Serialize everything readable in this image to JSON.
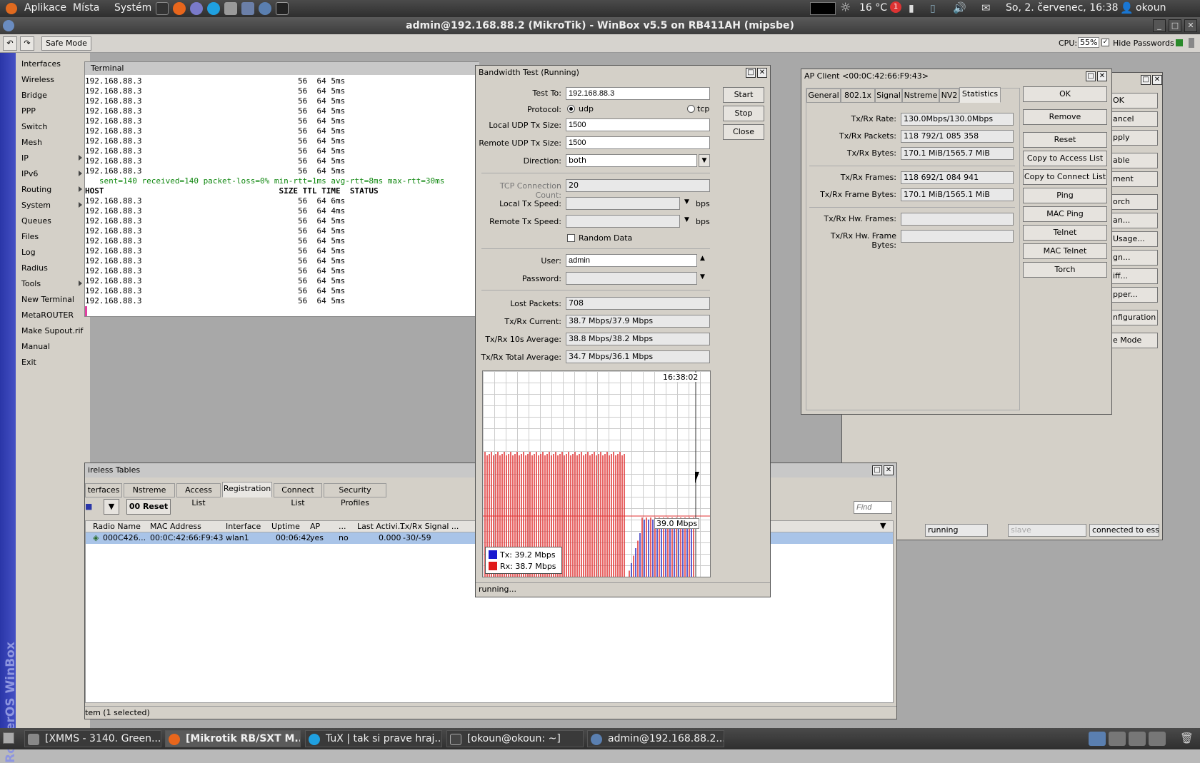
{
  "top_panel": {
    "menus": [
      "Aplikace",
      "Místa",
      "Systém"
    ],
    "temperature": "16 °C",
    "notification_count": "1",
    "datetime": "So, 2. červenec, 16:38",
    "user": "okoun"
  },
  "window": {
    "title": "admin@192.168.88.2 (MikroTik) - WinBox v5.5 on RB411AH (mipsbe)"
  },
  "toolbar": {
    "safe_mode": "Safe Mode",
    "cpu_label": "CPU:",
    "cpu_value": "55%",
    "hide_passwords": "Hide Passwords"
  },
  "sidebar": {
    "vertical_label": "RouterOS WinBox",
    "items": [
      "Interfaces",
      "Wireless",
      "Bridge",
      "PPP",
      "Switch",
      "Mesh",
      "IP",
      "IPv6",
      "Routing",
      "System",
      "Queues",
      "Files",
      "Log",
      "Radius",
      "Tools",
      "New Terminal",
      "MetaROUTER",
      "Make Supout.rif",
      "Manual",
      "Exit"
    ]
  },
  "terminal": {
    "title": "Terminal",
    "lines_top": [
      "192.168.88.3                                 56  64 5ms",
      "192.168.88.3                                 56  64 5ms",
      "192.168.88.3                                 56  64 5ms",
      "192.168.88.3                                 56  64 5ms",
      "192.168.88.3                                 56  64 5ms",
      "192.168.88.3                                 56  64 5ms",
      "192.168.88.3                                 56  64 5ms",
      "192.168.88.3                                 56  64 5ms",
      "192.168.88.3                                 56  64 5ms",
      "192.168.88.3                                 56  64 5ms"
    ],
    "summary": "   sent=140 received=140 packet-loss=0% min-rtt=1ms avg-rtt=8ms max-rtt=30ms",
    "header": "HOST                                     SIZE TTL TIME  STATUS",
    "lines_bottom": [
      "192.168.88.3                                 56  64 6ms",
      "192.168.88.3                                 56  64 4ms",
      "192.168.88.3                                 56  64 5ms",
      "192.168.88.3                                 56  64 5ms",
      "192.168.88.3                                 56  64 5ms",
      "192.168.88.3                                 56  64 5ms",
      "192.168.88.3                                 56  64 5ms",
      "192.168.88.3                                 56  64 5ms",
      "192.168.88.3                                 56  64 5ms",
      "192.168.88.3                                 56  64 5ms",
      "192.168.88.3                                 56  64 5ms"
    ]
  },
  "bandwidth_test": {
    "title": "Bandwidth Test (Running)",
    "test_to_label": "Test To:",
    "test_to": "192.168.88.3",
    "protocol_label": "Protocol:",
    "udp": "udp",
    "tcp": "tcp",
    "local_udp_label": "Local UDP Tx Size:",
    "local_udp": "1500",
    "remote_udp_label": "Remote UDP Tx Size:",
    "remote_udp": "1500",
    "direction_label": "Direction:",
    "direction": "both",
    "tcp_count_label": "TCP Connection Count:",
    "tcp_count": "20",
    "local_tx_label": "Local Tx Speed:",
    "remote_tx_label": "Remote Tx Speed:",
    "bps": "bps",
    "random_data": "Random Data",
    "user_label": "User:",
    "user": "admin",
    "password_label": "Password:",
    "lost_label": "Lost Packets:",
    "lost": "708",
    "current_label": "Tx/Rx Current:",
    "current": "38.7 Mbps/37.9 Mbps",
    "avg10_label": "Tx/Rx 10s Average:",
    "avg10": "38.8 Mbps/38.2 Mbps",
    "total_label": "Tx/Rx Total Average:",
    "total": "34.7 Mbps/36.1 Mbps",
    "start": "Start",
    "stop": "Stop",
    "close": "Close",
    "graph_time": "16:38:02",
    "graph_value": "39.0 Mbps",
    "legend_tx": "Tx:  39.2 Mbps",
    "legend_rx": "Rx:  38.7 Mbps",
    "status": "running..."
  },
  "ap_client": {
    "title": "AP Client <00:0C:42:66:F9:43>",
    "tabs": [
      "General",
      "802.1x",
      "Signal",
      "Nstreme",
      "NV2",
      "Statistics"
    ],
    "rows": [
      {
        "label": "Tx/Rx Rate:",
        "value": "130.0Mbps/130.0Mbps"
      },
      {
        "label": "Tx/Rx Packets:",
        "value": "118 792/1 085 358"
      },
      {
        "label": "Tx/Rx Bytes:",
        "value": "170.1 MiB/1565.7 MiB"
      },
      {
        "label": "Tx/Rx Frames:",
        "value": "118 692/1 084 941"
      },
      {
        "label": "Tx/Rx Frame Bytes:",
        "value": "170.1 MiB/1565.1 MiB"
      },
      {
        "label": "Tx/Rx Hw. Frames:",
        "value": ""
      },
      {
        "label": "Tx/Rx Hw. Frame Bytes:",
        "value": ""
      }
    ],
    "buttons": [
      "OK",
      "Remove",
      "Reset",
      "Copy to Access List",
      "Copy to Connect List",
      "Ping",
      "MAC Ping",
      "Telnet",
      "MAC Telnet",
      "Torch"
    ]
  },
  "back_window": {
    "buttons": [
      "OK",
      "ancel",
      "pply",
      "able",
      "ment",
      "orch",
      "an...",
      "Usage...",
      "gn...",
      "iff...",
      "pper...",
      "nfiguration",
      "e Mode"
    ],
    "status_running": "running",
    "status_slave": "slave",
    "status_connected": "connected to ess"
  },
  "wireless_tables": {
    "title": "ireless Tables",
    "tabs": [
      "terfaces",
      "Nstreme Dual",
      "Access List",
      "Registration",
      "Connect List",
      "Security Profiles"
    ],
    "reset": "00 Reset",
    "find_placeholder": "Find",
    "columns": [
      "Radio Name",
      "MAC Address",
      "Interface",
      "Uptime",
      "AP",
      "...",
      "Last Activi...",
      "Tx/Rx Signal ..."
    ],
    "row": [
      "000C426...",
      "00:0C:42:66:F9:43",
      "wlan1",
      "00:06:42",
      "yes",
      "no",
      "0.000",
      "-30/-59"
    ],
    "status": "tem (1 selected)"
  },
  "taskbar": {
    "items": [
      "[XMMS - 3140. Green...",
      "[Mikrotik RB/SXT M...",
      "TuX | tak si prave hraj...",
      "[okoun@okoun: ~]",
      "admin@192.168.88.2..."
    ]
  }
}
